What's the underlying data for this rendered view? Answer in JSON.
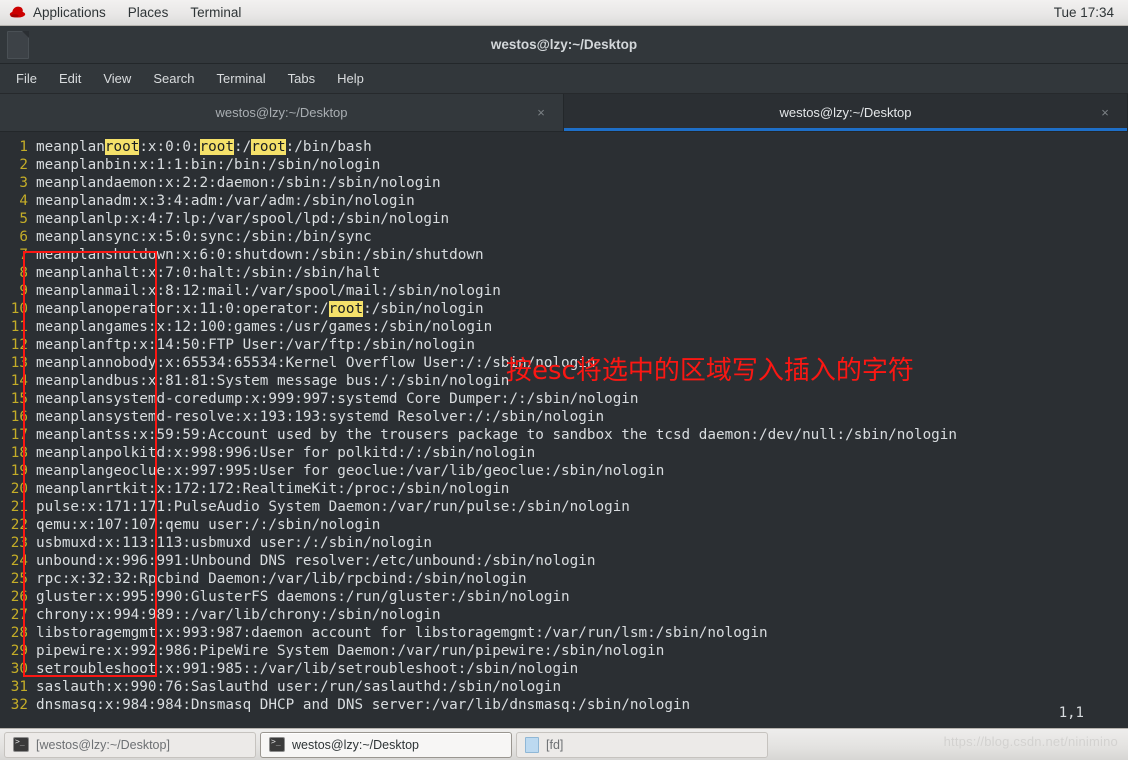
{
  "panel": {
    "logo_icon": "redhat-logo",
    "menus": [
      "Applications",
      "Places",
      "Terminal"
    ],
    "clock": "Tue 17:34"
  },
  "window": {
    "icon": "document-icon",
    "title": "westos@lzy:~/Desktop",
    "menubar": [
      "File",
      "Edit",
      "View",
      "Search",
      "Terminal",
      "Tabs",
      "Help"
    ],
    "tabs": [
      {
        "label": "westos@lzy:~/Desktop",
        "active": false,
        "close_icon": "×"
      },
      {
        "label": "westos@lzy:~/Desktop",
        "active": true,
        "close_icon": "×"
      }
    ]
  },
  "editor": {
    "cursor_position": "1,1",
    "annotation": "按esc将选中的区域写入插入的字符",
    "selection_box_color": "#fb1713",
    "highlight_color": "#f5e16a",
    "linenum_color": "#c4ad28",
    "lines": [
      {
        "n": "1",
        "parts": [
          {
            "t": "meanplan"
          },
          {
            "t": "root",
            "hl": true
          },
          {
            "t": ":x:0:0:"
          },
          {
            "t": "root",
            "hl": true
          },
          {
            "t": ":/"
          },
          {
            "t": "root",
            "hl": true
          },
          {
            "t": ":/bin/bash"
          }
        ]
      },
      {
        "n": "2",
        "parts": [
          {
            "t": "meanplanbin:x:1:1:bin:/bin:/sbin/nologin"
          }
        ]
      },
      {
        "n": "3",
        "parts": [
          {
            "t": "meanplandaemon:x:2:2:daemon:/sbin:/sbin/nologin"
          }
        ]
      },
      {
        "n": "4",
        "parts": [
          {
            "t": "meanplanadm:x:3:4:adm:/var/adm:/sbin/nologin"
          }
        ]
      },
      {
        "n": "5",
        "parts": [
          {
            "t": "meanplanlp:x:4:7:lp:/var/spool/lpd:/sbin/nologin"
          }
        ]
      },
      {
        "n": "6",
        "parts": [
          {
            "t": "meanplansync:x:5:0:sync:/sbin:/bin/sync"
          }
        ]
      },
      {
        "n": "7",
        "parts": [
          {
            "t": "meanplanshutdown:x:6:0:shutdown:/sbin:/sbin/shutdown"
          }
        ]
      },
      {
        "n": "8",
        "parts": [
          {
            "t": "meanplanhalt:x:7:0:halt:/sbin:/sbin/halt"
          }
        ]
      },
      {
        "n": "9",
        "parts": [
          {
            "t": "meanplanmail:x:8:12:mail:/var/spool/mail:/sbin/nologin"
          }
        ]
      },
      {
        "n": "10",
        "parts": [
          {
            "t": "meanplanoperator:x:11:0:operator:/"
          },
          {
            "t": "root",
            "hl": true
          },
          {
            "t": ":/sbin/nologin"
          }
        ]
      },
      {
        "n": "11",
        "parts": [
          {
            "t": "meanplangames:x:12:100:games:/usr/games:/sbin/nologin"
          }
        ]
      },
      {
        "n": "12",
        "parts": [
          {
            "t": "meanplanftp:x:14:50:FTP User:/var/ftp:/sbin/nologin"
          }
        ]
      },
      {
        "n": "13",
        "parts": [
          {
            "t": "meanplannobody:x:65534:65534:Kernel Overflow User:/:/sbin/nologin"
          }
        ]
      },
      {
        "n": "14",
        "parts": [
          {
            "t": "meanplandbus:x:81:81:System message bus:/:/sbin/nologin"
          }
        ]
      },
      {
        "n": "15",
        "parts": [
          {
            "t": "meanplansystemd-coredump:x:999:997:systemd Core Dumper:/:/sbin/nologin"
          }
        ]
      },
      {
        "n": "16",
        "parts": [
          {
            "t": "meanplansystemd-resolve:x:193:193:systemd Resolver:/:/sbin/nologin"
          }
        ]
      },
      {
        "n": "17",
        "parts": [
          {
            "t": "meanplantss:x:59:59:Account used by the trousers package to sandbox the tcsd daemon:/dev/null:/sbin/nologin"
          }
        ]
      },
      {
        "n": "18",
        "parts": [
          {
            "t": "meanplanpolkitd:x:998:996:User for polkitd:/:/sbin/nologin"
          }
        ]
      },
      {
        "n": "19",
        "parts": [
          {
            "t": "meanplangeoclue:x:997:995:User for geoclue:/var/lib/geoclue:/sbin/nologin"
          }
        ]
      },
      {
        "n": "20",
        "parts": [
          {
            "t": "meanplanrtkit:x:172:172:RealtimeKit:/proc:/sbin/nologin"
          }
        ]
      },
      {
        "n": "21",
        "parts": [
          {
            "t": "pulse:x:171:171:PulseAudio System Daemon:/var/run/pulse:/sbin/nologin"
          }
        ]
      },
      {
        "n": "22",
        "parts": [
          {
            "t": "qemu:x:107:107:qemu user:/:/sbin/nologin"
          }
        ]
      },
      {
        "n": "23",
        "parts": [
          {
            "t": "usbmuxd:x:113:113:usbmuxd user:/:/sbin/nologin"
          }
        ]
      },
      {
        "n": "24",
        "parts": [
          {
            "t": "unbound:x:996:991:Unbound DNS resolver:/etc/unbound:/sbin/nologin"
          }
        ]
      },
      {
        "n": "25",
        "parts": [
          {
            "t": "rpc:x:32:32:Rpcbind Daemon:/var/lib/rpcbind:/sbin/nologin"
          }
        ]
      },
      {
        "n": "26",
        "parts": [
          {
            "t": "gluster:x:995:990:GlusterFS daemons:/run/gluster:/sbin/nologin"
          }
        ]
      },
      {
        "n": "27",
        "parts": [
          {
            "t": "chrony:x:994:989::/var/lib/chrony:/sbin/nologin"
          }
        ]
      },
      {
        "n": "28",
        "parts": [
          {
            "t": "libstoragemgmt:x:993:987:daemon account for libstoragemgmt:/var/run/lsm:/sbin/nologin"
          }
        ]
      },
      {
        "n": "29",
        "parts": [
          {
            "t": "pipewire:x:992:986:PipeWire System Daemon:/var/run/pipewire:/sbin/nologin"
          }
        ]
      },
      {
        "n": "30",
        "parts": [
          {
            "t": "setroubleshoot:x:991:985::/var/lib/setroubleshoot:/sbin/nologin"
          }
        ]
      },
      {
        "n": "31",
        "parts": [
          {
            "t": "saslauth:x:990:76:Saslauthd user:/run/saslauthd:/sbin/nologin"
          }
        ]
      },
      {
        "n": "32",
        "parts": [
          {
            "t": "dnsmasq:x:984:984:Dnsmasq DHCP and DNS server:/var/lib/dnsmasq:/sbin/nologin"
          }
        ]
      }
    ]
  },
  "taskbar": {
    "items": [
      {
        "label": "[westos@lzy:~/Desktop]",
        "icon": "terminal-icon",
        "active": false
      },
      {
        "label": "westos@lzy:~/Desktop",
        "icon": "terminal-icon",
        "active": true
      },
      {
        "label": "[fd]",
        "icon": "file-icon",
        "active": false
      }
    ]
  },
  "watermark": "https://blog.csdn.net/ninimino"
}
